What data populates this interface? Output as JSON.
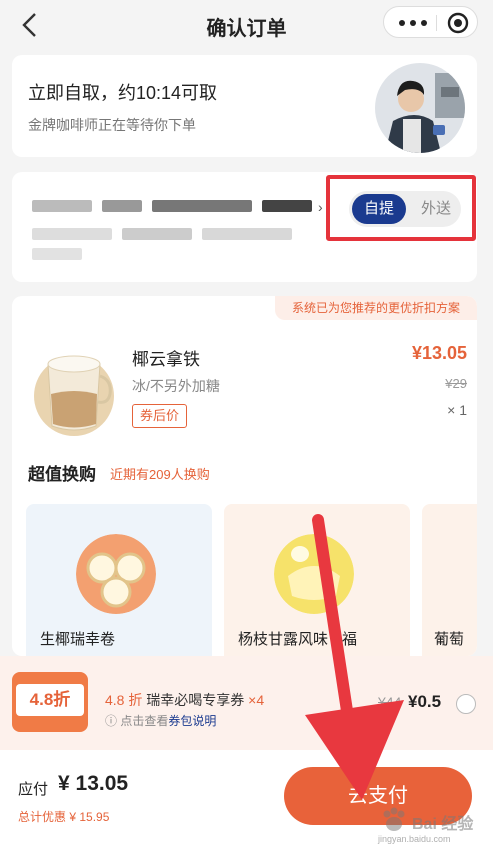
{
  "nav": {
    "title": "确认订单",
    "back_icon": "chevron-left-icon",
    "more_icon": "more-dots-icon",
    "close_icon": "target-icon"
  },
  "pickup": {
    "heading": "立即自取，约10:14可取",
    "subtitle": "金牌咖啡师正在等待你下单"
  },
  "mode": {
    "active": "自提",
    "inactive": "外送",
    "highlight_color": "#e5333b"
  },
  "recommend_tip": "系统已为您推荐的更优折扣方案",
  "product": {
    "name": "椰云拿铁",
    "options": "冰/不另外加糖",
    "tag": "券后价",
    "price": "¥13.05",
    "original_price": "¥29",
    "quantity": "× 1"
  },
  "exchange": {
    "title": "超值换购",
    "subtitle": "近期有209人换购",
    "items": [
      {
        "label": "生椰瑞幸卷"
      },
      {
        "label": "杨枝甘露风味",
        "label_tail": "福"
      },
      {
        "label": "葡萄"
      }
    ]
  },
  "coupon": {
    "badge": "4.8折",
    "highlight": "4.8 折",
    "name": "瑞幸必喝专享券",
    "count": "×4",
    "info_prefix": "点击查看",
    "info_link": "券包说明",
    "original": "¥44",
    "price": "¥0.5"
  },
  "footer": {
    "due_label": "应付",
    "due_value": "¥ 13.05",
    "discount": "总计优惠 ¥ 15.95",
    "pay_label": "去支付"
  },
  "watermark": {
    "text": "Bai 经验",
    "sub": "jingyan.baidu.com"
  },
  "colors": {
    "brand_blue": "#1a3a8f",
    "accent_orange": "#e5633a",
    "arrow_red": "#e8383f"
  }
}
